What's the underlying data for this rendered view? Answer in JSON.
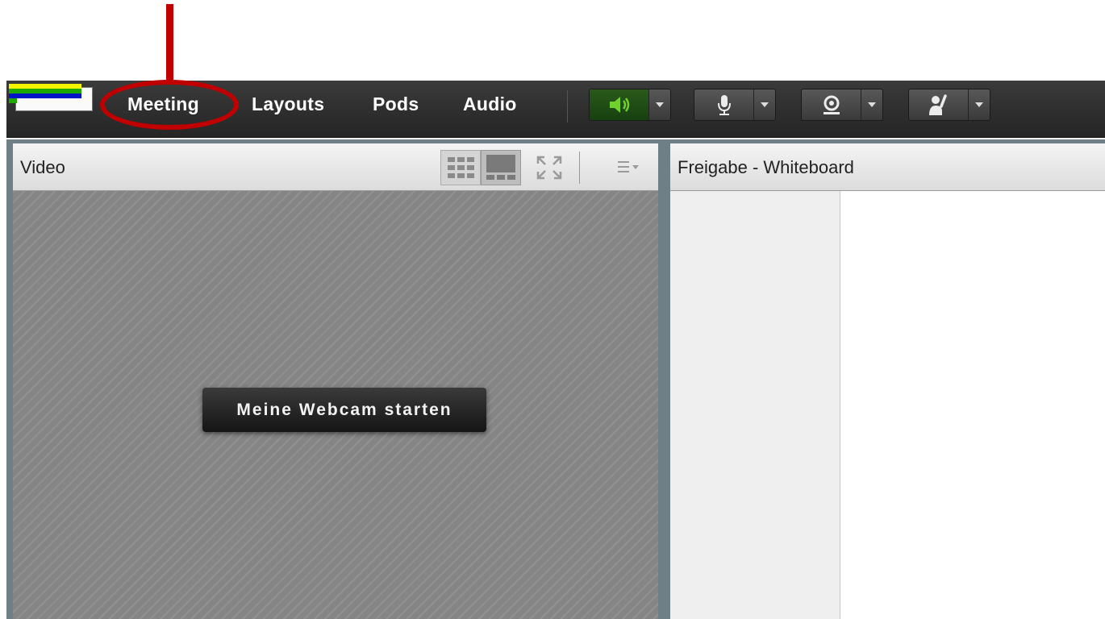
{
  "menu": {
    "items": [
      {
        "label": "Meeting"
      },
      {
        "label": "Layouts"
      },
      {
        "label": "Pods"
      },
      {
        "label": "Audio"
      }
    ]
  },
  "toolbar": {
    "speaker": {
      "state": "on",
      "color": "#6fd02e"
    },
    "microphone": {},
    "webcam": {},
    "raise_hand": {}
  },
  "video_pod": {
    "title": "Video",
    "start_webcam_label": "Meine Webcam starten"
  },
  "share_pod": {
    "title": "Freigabe - Whiteboard"
  },
  "annotation": {
    "highlight_color": "#c00000",
    "highlighted_item": "Meeting"
  }
}
